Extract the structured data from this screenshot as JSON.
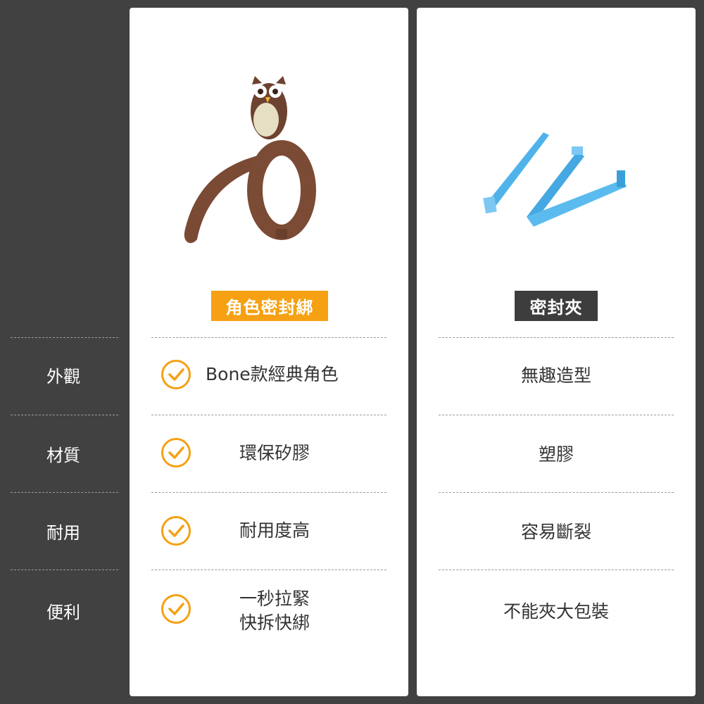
{
  "columns": {
    "left": {
      "title": "角色密封綁",
      "badge_color": "#f5a113",
      "image_icon": "owl-tie-icon"
    },
    "right": {
      "title": "密封夾",
      "badge_color": "#3d3d3d",
      "image_icon": "bag-clip-icon"
    }
  },
  "rows": [
    {
      "label": "外觀",
      "left_lines": [
        "Bone款經典角色"
      ],
      "right": "無趣造型"
    },
    {
      "label": "材質",
      "left_lines": [
        "環保矽膠"
      ],
      "right": "塑膠"
    },
    {
      "label": "耐用",
      "left_lines": [
        "耐用度高"
      ],
      "right": "容易斷裂"
    },
    {
      "label": "便利",
      "left_lines": [
        "一秒拉緊",
        "快拆快綁"
      ],
      "right": "不能夾大包裝"
    }
  ],
  "check_icon": "check-circle-icon",
  "accent_color": "#f5a113"
}
